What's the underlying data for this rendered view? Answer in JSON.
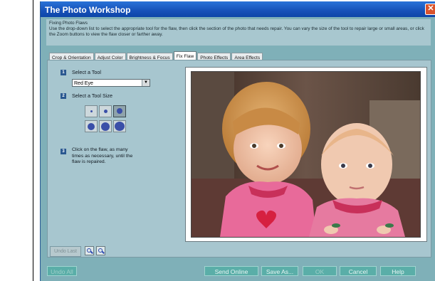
{
  "window": {
    "title": "The Photo Workshop",
    "close_glyph": "✕"
  },
  "description": {
    "heading": "Fixing Photo Flaws",
    "body": "Use the drop-down list to select the appropriate tool for the flaw, then click the section of the photo that needs repair. You can vary the size of the tool to repair large or small areas, or click the Zoom buttons to view the flaw closer or farther away."
  },
  "tabs": [
    {
      "label": "Crop & Orientation"
    },
    {
      "label": "Adjust Color"
    },
    {
      "label": "Brightness & Focus"
    },
    {
      "label": "Fix Flaw",
      "active": true
    },
    {
      "label": "Photo Effects"
    },
    {
      "label": "Area Effects"
    }
  ],
  "steps": {
    "step1": {
      "number": "1",
      "label": "Select a Tool"
    },
    "tool_select": {
      "value": "Red Eye"
    },
    "step2": {
      "number": "2",
      "label": "Select a Tool Size"
    },
    "step3": {
      "number": "3",
      "label": "Click on the flaw, as many times as necessary, until the flaw is repaired."
    }
  },
  "tool_sizes": [
    {
      "name": "tool-size-1",
      "selected": false
    },
    {
      "name": "tool-size-2",
      "selected": false
    },
    {
      "name": "tool-size-3",
      "selected": true
    },
    {
      "name": "tool-size-4",
      "selected": false
    },
    {
      "name": "tool-size-5",
      "selected": false
    },
    {
      "name": "tool-size-6",
      "selected": false
    }
  ],
  "controls": {
    "undo_last": "Undo Last",
    "zoom_in_icon": "zoom-in-icon",
    "zoom_out_icon": "zoom-out-icon"
  },
  "footer": {
    "undo_all": "Undo All",
    "send_online": "Send Online",
    "save_as": "Save As...",
    "ok": "OK",
    "cancel": "Cancel",
    "help": "Help"
  },
  "colors": {
    "window_bg": "#7fb0b8",
    "titlebar": "#1651b8",
    "footer_button": "#5aaea8",
    "step_badge": "#2a5890"
  }
}
